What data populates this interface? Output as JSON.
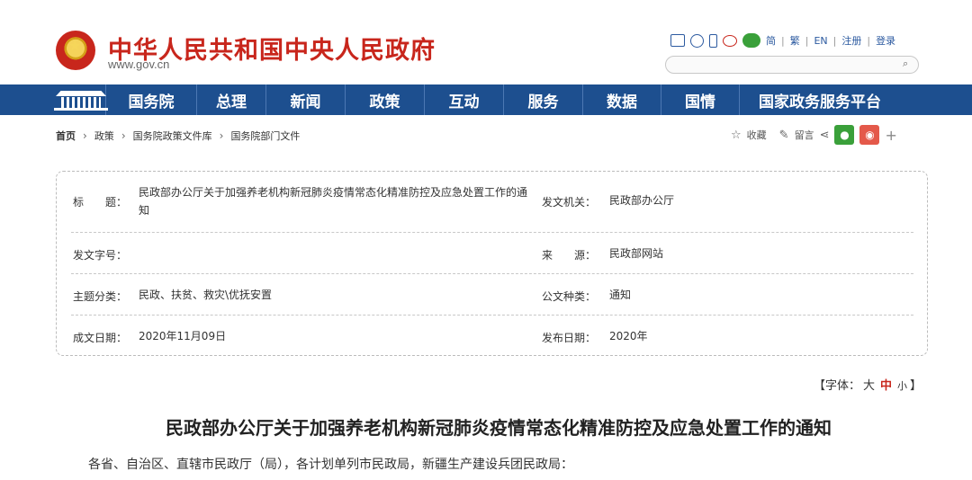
{
  "header": {
    "site_title": "中华人民共和国中央人民政府",
    "site_url": "www.gov.cn",
    "links": [
      "简",
      "繁",
      "EN",
      "注册",
      "登录"
    ],
    "search_placeholder": ""
  },
  "nav": {
    "items": [
      "国务院",
      "总理",
      "新闻",
      "政策",
      "互动",
      "服务",
      "数据",
      "国情",
      "国家政务服务平台"
    ]
  },
  "breadcrumb": [
    "首页",
    "政策",
    "国务院政策文件库",
    "国务院部门文件"
  ],
  "tools": {
    "favorite": "收藏",
    "comment": "留言"
  },
  "info": {
    "title_label": "标　　题：",
    "title_value": "民政部办公厅关于加强养老机构新冠肺炎疫情常态化精准防控及应急处置工作的通知",
    "issuer_label": "发文机关：",
    "issuer_value": "民政部办公厅",
    "docno_label": "发文字号：",
    "docno_value": "",
    "source_label": "来　　源：",
    "source_value": "民政部网站",
    "topic_label": "主题分类：",
    "topic_value": "民政、扶贫、救灾\\优抚安置",
    "type_label": "公文种类：",
    "type_value": "通知",
    "date_label": "成文日期：",
    "date_value": "2020年11月09日",
    "pub_label": "发布日期：",
    "pub_value": "2020年"
  },
  "font_ctrl": {
    "prefix": "【字体：",
    "large": "大",
    "medium": "中",
    "small": "小",
    "suffix": "】"
  },
  "document": {
    "title": "民政部办公厅关于加强养老机构新冠肺炎疫情常态化精准防控及应急处置工作的通知",
    "first_line": "各省、自治区、直辖市民政厅（局），各计划单列市民政局，新疆生产建设兵团民政局："
  },
  "colors": {
    "brand_red": "#c8261c",
    "nav_blue": "#1d4f8f",
    "link_blue": "#2c5aa0"
  }
}
